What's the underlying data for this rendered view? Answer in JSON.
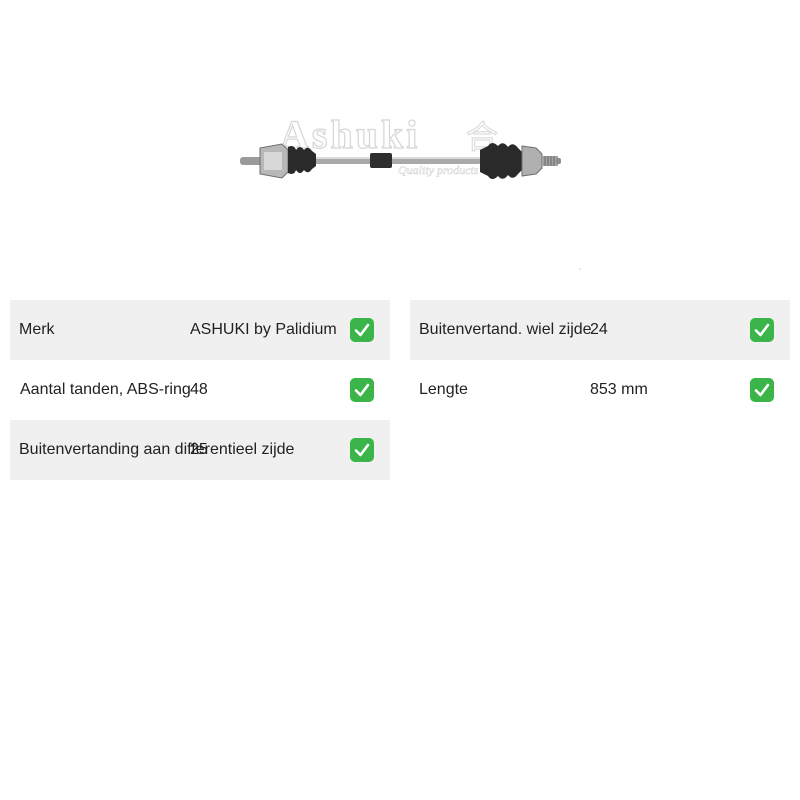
{
  "product_image": {
    "icon": "drive-shaft-image",
    "watermark_brand": "Ashuki",
    "watermark_tagline": "Quality products"
  },
  "specs_left": [
    {
      "label": "Merk",
      "value": "ASHUKI by Palidium",
      "check_icon": "check-icon"
    },
    {
      "label": "Aantal tanden, ABS-ring",
      "value": "48",
      "check_icon": "check-icon"
    },
    {
      "label": "Buitenvertanding aan differentieel zijde",
      "value": "25",
      "check_icon": "check-icon"
    }
  ],
  "specs_right": [
    {
      "label": "Buitenvertand. wiel zijde",
      "value": "24",
      "check_icon": "check-icon"
    },
    {
      "label": "Lengte",
      "value": "853 mm",
      "check_icon": "check-icon"
    }
  ],
  "colors": {
    "row_shade": "#f0f0f0",
    "check_green": "#3bb54a"
  }
}
